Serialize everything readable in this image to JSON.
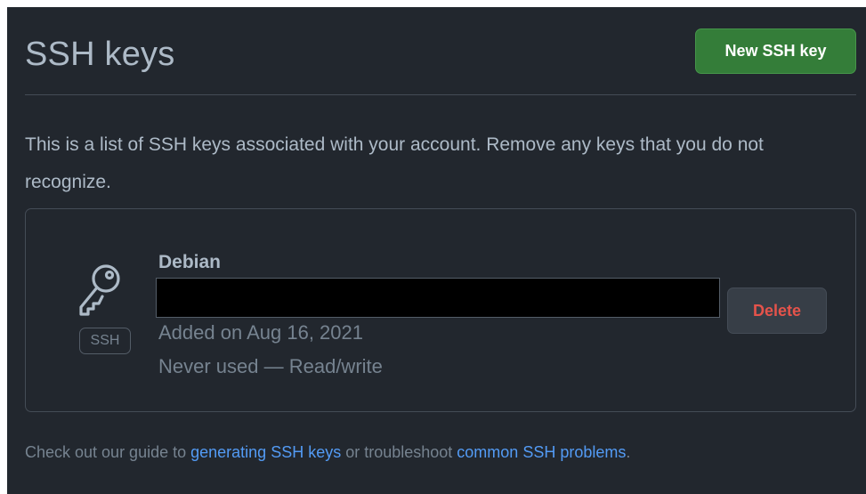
{
  "header": {
    "title": "SSH keys",
    "new_key_label": "New SSH key"
  },
  "description": "This is a list of SSH keys associated with your account. Remove any keys that you do not recognize.",
  "keys": [
    {
      "type_label": "SSH",
      "title": "Debian",
      "fingerprint": "",
      "added": "Added on Aug 16, 2021",
      "usage": "Never used — Read/write",
      "delete_label": "Delete"
    }
  ],
  "footer": {
    "prefix": "Check out our guide to ",
    "link1": "generating SSH keys",
    "middle": " or troubleshoot ",
    "link2": "common SSH problems",
    "suffix": "."
  },
  "colors": {
    "background": "#22272e",
    "primary_button": "#347d39",
    "danger_text": "#e5534b",
    "link": "#539bf5"
  },
  "icons": {
    "key": "key-icon"
  }
}
